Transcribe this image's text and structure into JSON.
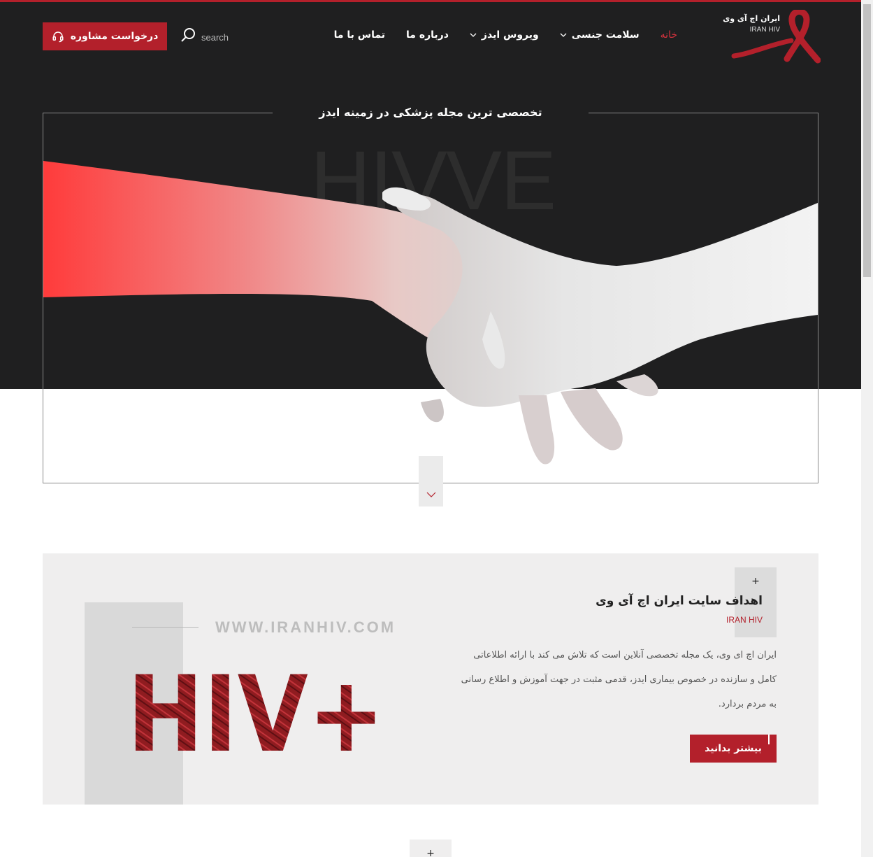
{
  "header": {
    "consult_label": "درخواست مشاوره",
    "search_label": "search",
    "nav": [
      {
        "label": "خانه",
        "active": true,
        "has_dropdown": false
      },
      {
        "label": "سلامت جنسی",
        "active": false,
        "has_dropdown": true
      },
      {
        "label": "ویروس ایدز",
        "active": false,
        "has_dropdown": true
      },
      {
        "label": "درباره ما",
        "active": false,
        "has_dropdown": false
      },
      {
        "label": "تماس با ما",
        "active": false,
        "has_dropdown": false
      }
    ],
    "logo_fa": "ایران اچ آی وی",
    "logo_en": "IRAN HIV",
    "logo_icon": "red-ribbon-icon"
  },
  "hero": {
    "tagline": "تخصصی ترین مجله پزشکی در زمینه ایدز",
    "watermark": "HIVVE",
    "scroll_icon": "chevron-down-icon"
  },
  "about": {
    "plus_symbol": "+",
    "title": "اهداف سایت ایران اچ آی وی",
    "subtitle": "IRAN HIV",
    "lines": [
      "ایران اچ ای وی،  یک مجله تخصصی آنلاین است که تلاش می کند با ارائه اطلاعاتی",
      "کامل و سازنده در خصوص بیماری ایدز، قدمی مثبت در جهت آموزش و اطلاع رسانی",
      "به مردم بردارد."
    ],
    "more_label": "بیشتر بدانید",
    "site_url": "WWW.IRANHIV.COM",
    "art_text": "HIV+"
  },
  "next_section": {
    "plus_symbol": "+"
  },
  "colors": {
    "brand_red": "#b3202b",
    "dark_bg": "#1f1f20",
    "section_bg": "#efeeee"
  }
}
